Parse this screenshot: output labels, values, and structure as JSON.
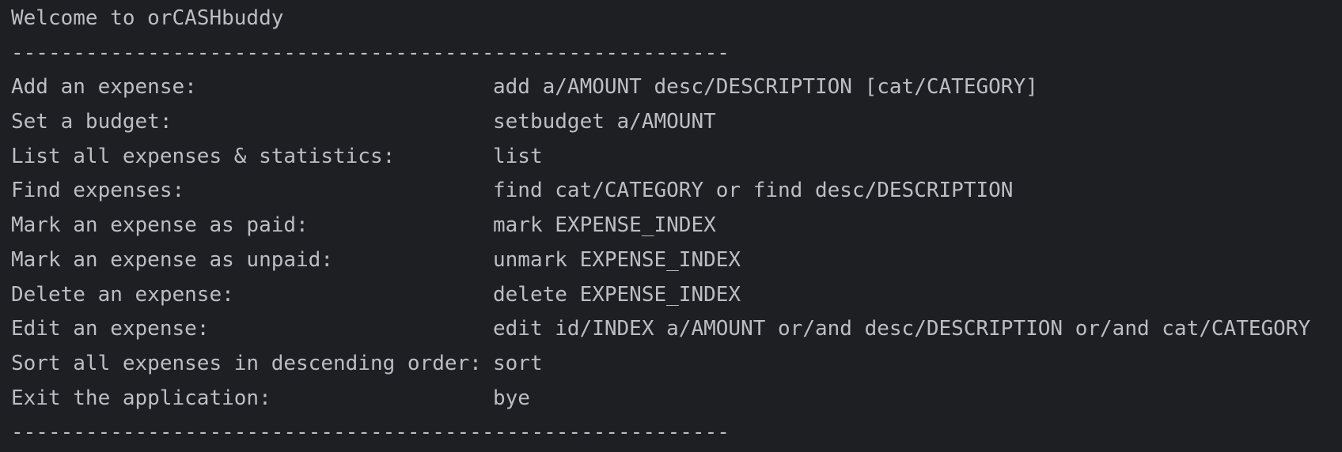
{
  "console": {
    "welcome": "Welcome to orCASHbuddy",
    "separator": "----------------------------------------------------------",
    "commands": [
      {
        "label": "Add an expense:",
        "command": "add a/AMOUNT desc/DESCRIPTION [cat/CATEGORY]"
      },
      {
        "label": "Set a budget:",
        "command": "setbudget a/AMOUNT"
      },
      {
        "label": "List all expenses & statistics:",
        "command": "list"
      },
      {
        "label": "Find expenses:",
        "command": "find cat/CATEGORY or find desc/DESCRIPTION"
      },
      {
        "label": "Mark an expense as paid:",
        "command": "mark EXPENSE_INDEX"
      },
      {
        "label": "Mark an expense as unpaid:",
        "command": "unmark EXPENSE_INDEX"
      },
      {
        "label": "Delete an expense:",
        "command": "delete EXPENSE_INDEX"
      },
      {
        "label": "Edit an expense:",
        "command": "edit id/INDEX a/AMOUNT or/and desc/DESCRIPTION or/and cat/CATEGORY"
      },
      {
        "label": "Sort all expenses in descending order:",
        "command": "sort"
      },
      {
        "label": "Exit the application:",
        "command": "bye"
      }
    ],
    "separator_bottom": "----------------------------------------------------------"
  }
}
